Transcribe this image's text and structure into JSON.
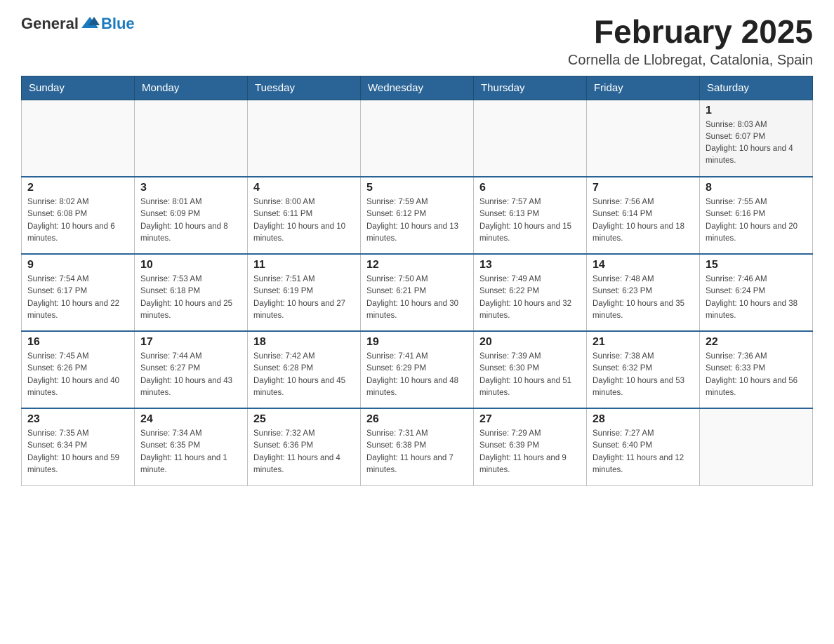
{
  "header": {
    "logo_text_general": "General",
    "logo_text_blue": "Blue",
    "title": "February 2025",
    "subtitle": "Cornella de Llobregat, Catalonia, Spain"
  },
  "calendar": {
    "days_of_week": [
      "Sunday",
      "Monday",
      "Tuesday",
      "Wednesday",
      "Thursday",
      "Friday",
      "Saturday"
    ],
    "weeks": [
      [
        {
          "day": "",
          "info": ""
        },
        {
          "day": "",
          "info": ""
        },
        {
          "day": "",
          "info": ""
        },
        {
          "day": "",
          "info": ""
        },
        {
          "day": "",
          "info": ""
        },
        {
          "day": "",
          "info": ""
        },
        {
          "day": "1",
          "info": "Sunrise: 8:03 AM\nSunset: 6:07 PM\nDaylight: 10 hours and 4 minutes."
        }
      ],
      [
        {
          "day": "2",
          "info": "Sunrise: 8:02 AM\nSunset: 6:08 PM\nDaylight: 10 hours and 6 minutes."
        },
        {
          "day": "3",
          "info": "Sunrise: 8:01 AM\nSunset: 6:09 PM\nDaylight: 10 hours and 8 minutes."
        },
        {
          "day": "4",
          "info": "Sunrise: 8:00 AM\nSunset: 6:11 PM\nDaylight: 10 hours and 10 minutes."
        },
        {
          "day": "5",
          "info": "Sunrise: 7:59 AM\nSunset: 6:12 PM\nDaylight: 10 hours and 13 minutes."
        },
        {
          "day": "6",
          "info": "Sunrise: 7:57 AM\nSunset: 6:13 PM\nDaylight: 10 hours and 15 minutes."
        },
        {
          "day": "7",
          "info": "Sunrise: 7:56 AM\nSunset: 6:14 PM\nDaylight: 10 hours and 18 minutes."
        },
        {
          "day": "8",
          "info": "Sunrise: 7:55 AM\nSunset: 6:16 PM\nDaylight: 10 hours and 20 minutes."
        }
      ],
      [
        {
          "day": "9",
          "info": "Sunrise: 7:54 AM\nSunset: 6:17 PM\nDaylight: 10 hours and 22 minutes."
        },
        {
          "day": "10",
          "info": "Sunrise: 7:53 AM\nSunset: 6:18 PM\nDaylight: 10 hours and 25 minutes."
        },
        {
          "day": "11",
          "info": "Sunrise: 7:51 AM\nSunset: 6:19 PM\nDaylight: 10 hours and 27 minutes."
        },
        {
          "day": "12",
          "info": "Sunrise: 7:50 AM\nSunset: 6:21 PM\nDaylight: 10 hours and 30 minutes."
        },
        {
          "day": "13",
          "info": "Sunrise: 7:49 AM\nSunset: 6:22 PM\nDaylight: 10 hours and 32 minutes."
        },
        {
          "day": "14",
          "info": "Sunrise: 7:48 AM\nSunset: 6:23 PM\nDaylight: 10 hours and 35 minutes."
        },
        {
          "day": "15",
          "info": "Sunrise: 7:46 AM\nSunset: 6:24 PM\nDaylight: 10 hours and 38 minutes."
        }
      ],
      [
        {
          "day": "16",
          "info": "Sunrise: 7:45 AM\nSunset: 6:26 PM\nDaylight: 10 hours and 40 minutes."
        },
        {
          "day": "17",
          "info": "Sunrise: 7:44 AM\nSunset: 6:27 PM\nDaylight: 10 hours and 43 minutes."
        },
        {
          "day": "18",
          "info": "Sunrise: 7:42 AM\nSunset: 6:28 PM\nDaylight: 10 hours and 45 minutes."
        },
        {
          "day": "19",
          "info": "Sunrise: 7:41 AM\nSunset: 6:29 PM\nDaylight: 10 hours and 48 minutes."
        },
        {
          "day": "20",
          "info": "Sunrise: 7:39 AM\nSunset: 6:30 PM\nDaylight: 10 hours and 51 minutes."
        },
        {
          "day": "21",
          "info": "Sunrise: 7:38 AM\nSunset: 6:32 PM\nDaylight: 10 hours and 53 minutes."
        },
        {
          "day": "22",
          "info": "Sunrise: 7:36 AM\nSunset: 6:33 PM\nDaylight: 10 hours and 56 minutes."
        }
      ],
      [
        {
          "day": "23",
          "info": "Sunrise: 7:35 AM\nSunset: 6:34 PM\nDaylight: 10 hours and 59 minutes."
        },
        {
          "day": "24",
          "info": "Sunrise: 7:34 AM\nSunset: 6:35 PM\nDaylight: 11 hours and 1 minute."
        },
        {
          "day": "25",
          "info": "Sunrise: 7:32 AM\nSunset: 6:36 PM\nDaylight: 11 hours and 4 minutes."
        },
        {
          "day": "26",
          "info": "Sunrise: 7:31 AM\nSunset: 6:38 PM\nDaylight: 11 hours and 7 minutes."
        },
        {
          "day": "27",
          "info": "Sunrise: 7:29 AM\nSunset: 6:39 PM\nDaylight: 11 hours and 9 minutes."
        },
        {
          "day": "28",
          "info": "Sunrise: 7:27 AM\nSunset: 6:40 PM\nDaylight: 11 hours and 12 minutes."
        },
        {
          "day": "",
          "info": ""
        }
      ]
    ]
  }
}
